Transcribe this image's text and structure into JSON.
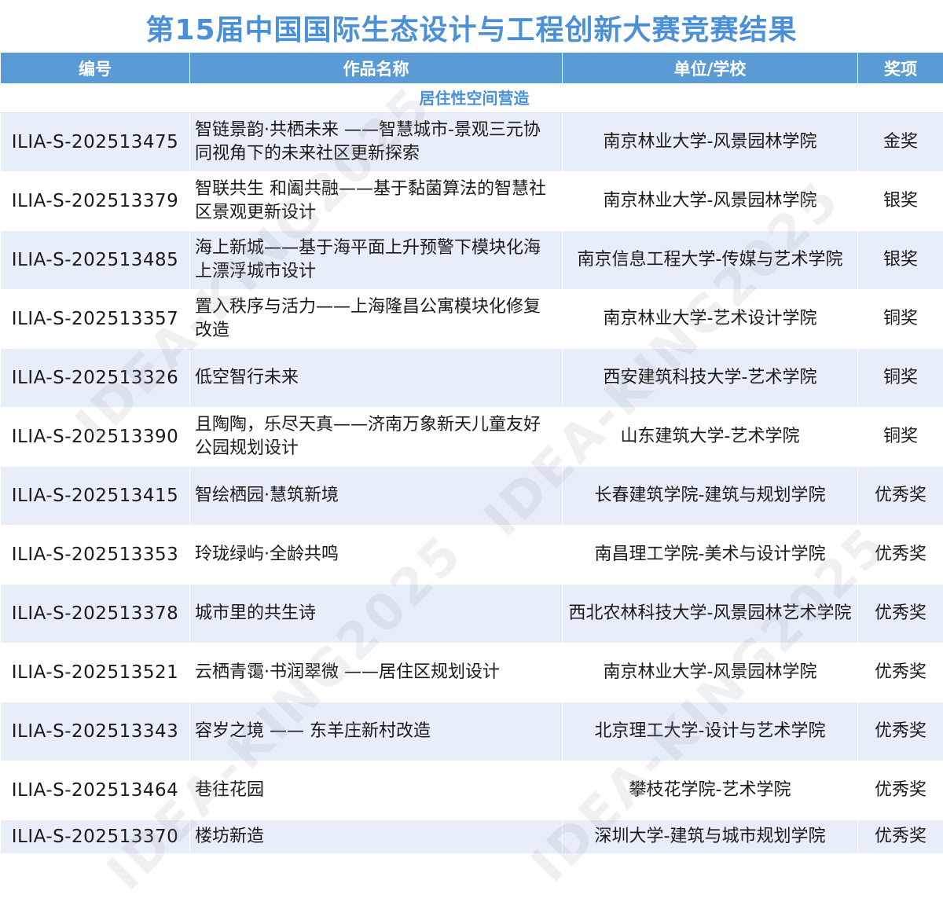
{
  "title": "第15届中国国际生态设计与工程创新大赛竞赛结果",
  "headers": {
    "id": "编号",
    "name": "作品名称",
    "unit": "单位/学校",
    "award": "奖项"
  },
  "section": "居住性空间营造",
  "rows": [
    {
      "id": "ILIA-S-202513475",
      "name": "智链景韵·共栖未来 ——智慧城市-景观三元协同视角下的未来社区更新探索",
      "unit": "南京林业大学-风景园林学院",
      "award": "金奖"
    },
    {
      "id": "ILIA-S-202513379",
      "name": "智联共生 和阖共融——基于黏菌算法的智慧社区景观更新设计",
      "unit": "南京林业大学-风景园林学院",
      "award": "银奖"
    },
    {
      "id": "ILIA-S-202513485",
      "name": "海上新城——基于海平面上升预警下模块化海上漂浮城市设计",
      "unit": "南京信息工程大学-传媒与艺术学院",
      "award": "银奖"
    },
    {
      "id": "ILIA-S-202513357",
      "name": "置入秩序与活力——上海隆昌公寓模块化修复改造",
      "unit": "南京林业大学-艺术设计学院",
      "award": "铜奖"
    },
    {
      "id": "ILIA-S-202513326",
      "name": "低空智行未来",
      "unit": "西安建筑科技大学-艺术学院",
      "award": "铜奖"
    },
    {
      "id": "ILIA-S-202513390",
      "name": "且陶陶，乐尽天真——济南万象新天儿童友好公园规划设计",
      "unit": "山东建筑大学-艺术学院",
      "award": "铜奖"
    },
    {
      "id": "ILIA-S-202513415",
      "name": "智绘栖园·慧筑新境",
      "unit": "长春建筑学院-建筑与规划学院",
      "award": "优秀奖"
    },
    {
      "id": "ILIA-S-202513353",
      "name": "玲珑绿屿·全龄共鸣",
      "unit": "南昌理工学院-美术与设计学院",
      "award": "优秀奖"
    },
    {
      "id": "ILIA-S-202513378",
      "name": "城市里的共生诗",
      "unit": "西北农林科技大学-风景园林艺术学院",
      "award": "优秀奖"
    },
    {
      "id": "ILIA-S-202513521",
      "name": "云栖青霭·书润翠微 ——居住区规划设计",
      "unit": "南京林业大学-风景园林学院",
      "award": "优秀奖"
    },
    {
      "id": "ILIA-S-202513343",
      "name": "容岁之境 —— 东羊庄新村改造",
      "unit": "北京理工大学-设计与艺术学院",
      "award": "优秀奖"
    },
    {
      "id": "ILIA-S-202513464",
      "name": "巷往花园",
      "unit": "攀枝花学院-艺术学院",
      "award": "优秀奖"
    },
    {
      "id": "ILIA-S-202513370",
      "name": "楼坊新造",
      "unit": "深圳大学-建筑与城市规划学院",
      "award": "优秀奖"
    }
  ],
  "watermark": "IDEA-KING2025"
}
